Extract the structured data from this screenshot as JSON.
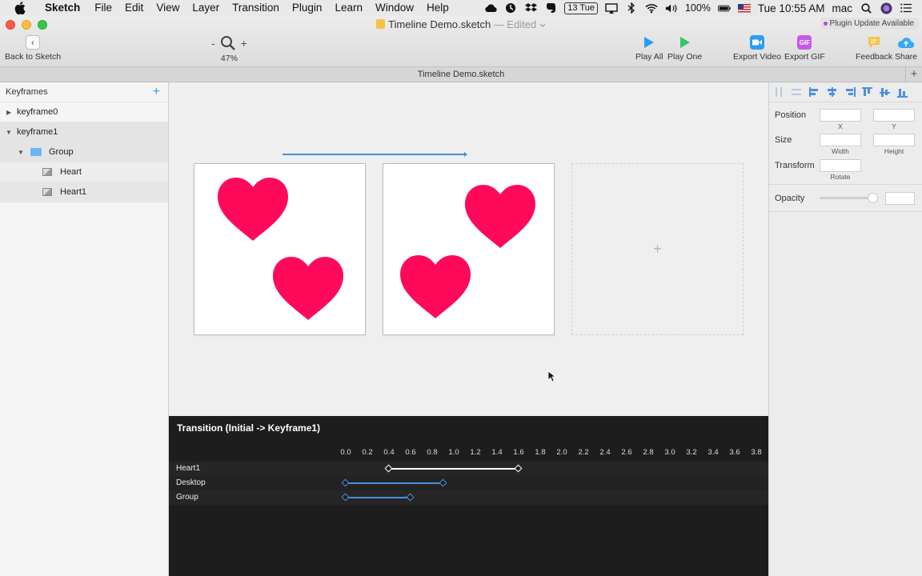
{
  "menubar": {
    "app": "Sketch",
    "items": [
      "File",
      "Edit",
      "View",
      "Layer",
      "Transition",
      "Plugin",
      "Learn",
      "Window",
      "Help"
    ],
    "date_badge": "13 Tue",
    "battery": "100%",
    "clock": "Tue 10:55 AM",
    "user": "mac"
  },
  "window": {
    "title": "Timeline Demo.sketch",
    "edited": " — Edited",
    "plugin_badge": "Plugin Update Available",
    "tab_title": "Timeline Demo.sketch"
  },
  "toolbar": {
    "back_label": "Back to Sketch",
    "zoom_minus": "-",
    "zoom_plus": "+",
    "zoom_level": "47%",
    "play_all": "Play All",
    "play_one": "Play One",
    "export_video": "Export Video",
    "export_gif": "Export GIF",
    "gif_badge": "GIF",
    "feedback": "Feedback",
    "share": "Share"
  },
  "left_panel": {
    "header": "Keyframes",
    "add": "+",
    "rows": [
      {
        "label": "keyframe0",
        "expanded": false
      },
      {
        "label": "keyframe1",
        "expanded": true
      },
      {
        "label": "Group",
        "expanded": true
      },
      {
        "label": "Heart"
      },
      {
        "label": "Heart1"
      }
    ]
  },
  "canvas": {
    "add_artboard": "+",
    "heart_color": "#ff0a5a"
  },
  "inspector": {
    "position": "Position",
    "x": "X",
    "y": "Y",
    "size": "Size",
    "width": "Width",
    "height": "Height",
    "transform": "Transform",
    "rotate": "Rotate",
    "opacity": "Opacity",
    "opacity_level": 0.95
  },
  "timeline": {
    "title": "Transition (Initial -> Keyframe1)",
    "ticks": [
      "0.0",
      "0.2",
      "0.4",
      "0.6",
      "0.8",
      "1.0",
      "1.2",
      "1.4",
      "1.6",
      "1.8",
      "2.0",
      "2.2",
      "2.4",
      "2.6",
      "2.8",
      "3.0",
      "3.2",
      "3.4",
      "3.6",
      "3.8"
    ],
    "tracks": [
      {
        "name": "Heart1",
        "start": 0.4,
        "end": 1.6,
        "color": "#ffffff"
      },
      {
        "name": "Desktop",
        "start": 0.0,
        "end": 0.9,
        "color": "#4a90e2"
      },
      {
        "name": "Group",
        "start": 0.0,
        "end": 0.6,
        "color": "#4a90e2"
      }
    ]
  }
}
